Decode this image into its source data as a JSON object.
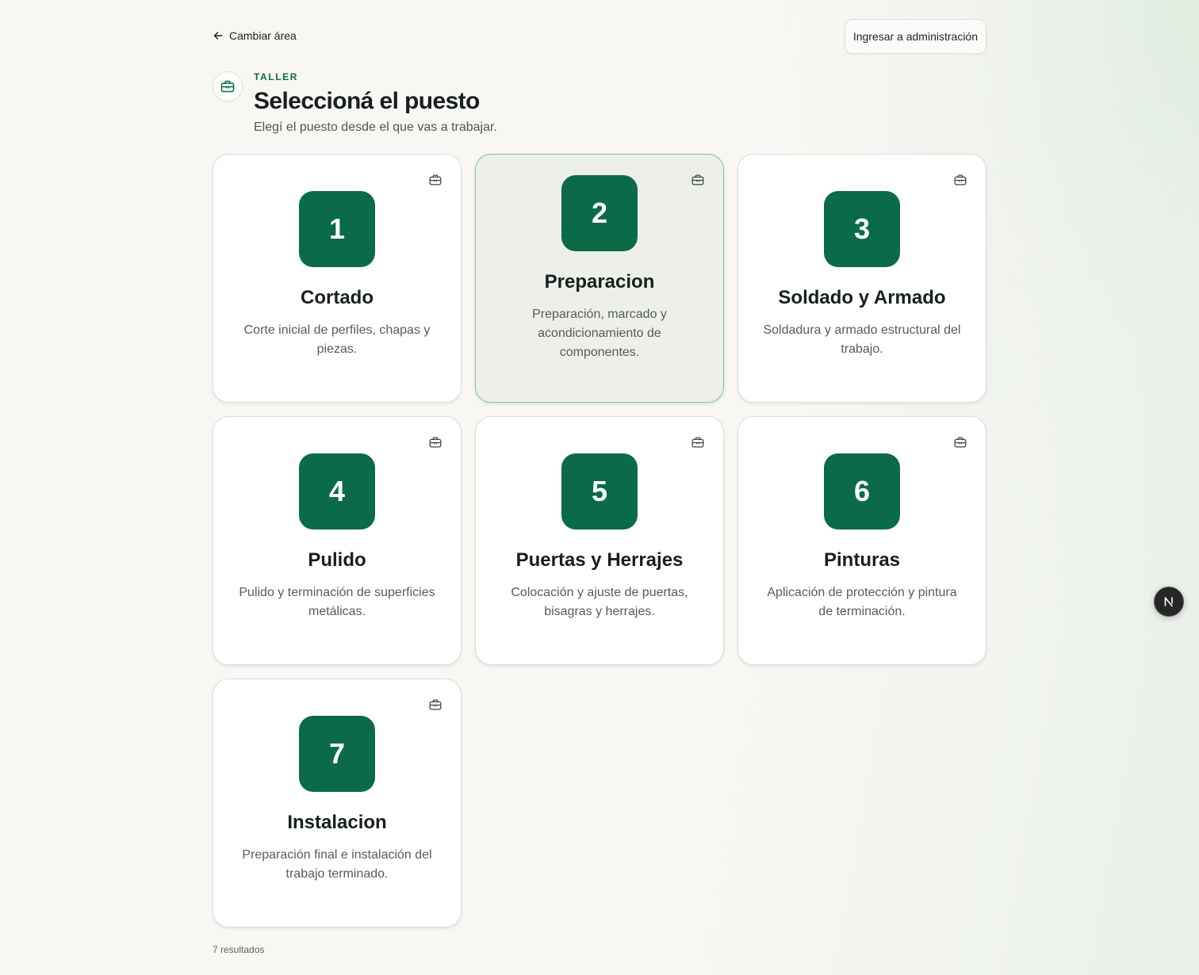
{
  "nav": {
    "back_label": "Cambiar área",
    "admin_label": "Ingresar a administración"
  },
  "header": {
    "eyebrow": "TALLER",
    "title": "Seleccioná el puesto",
    "subtitle": "Elegí el puesto desde el que vas a trabajar."
  },
  "stations": [
    {
      "number": "1",
      "title": "Cortado",
      "description": "Corte inicial de perfiles, chapas y piezas.",
      "hovered": false
    },
    {
      "number": "2",
      "title": "Preparacion",
      "description": "Preparación, marcado y acondicionamiento de componentes.",
      "hovered": true
    },
    {
      "number": "3",
      "title": "Soldado y Armado",
      "description": "Soldadura y armado estructural del trabajo.",
      "hovered": false
    },
    {
      "number": "4",
      "title": "Pulido",
      "description": "Pulido y terminación de superficies metálicas.",
      "hovered": false
    },
    {
      "number": "5",
      "title": "Puertas y Herrajes",
      "description": "Colocación y ajuste de puertas, bisagras y herrajes.",
      "hovered": false
    },
    {
      "number": "6",
      "title": "Pinturas",
      "description": "Aplicación de protección y pintura de terminación.",
      "hovered": false
    },
    {
      "number": "7",
      "title": "Instalacion",
      "description": "Preparación final e instalación del trabajo terminado.",
      "hovered": false
    }
  ],
  "footer": {
    "results_label": "7 resultados"
  },
  "icons": {
    "back": "arrow-left-icon",
    "header": "toolbox-icon",
    "card": "toolbox-icon",
    "dev_badge": "nextjs-logo-icon"
  },
  "colors": {
    "accent": "#0b6a48",
    "hover_border": "#8fbfa4",
    "hover_background": "#edefea"
  }
}
